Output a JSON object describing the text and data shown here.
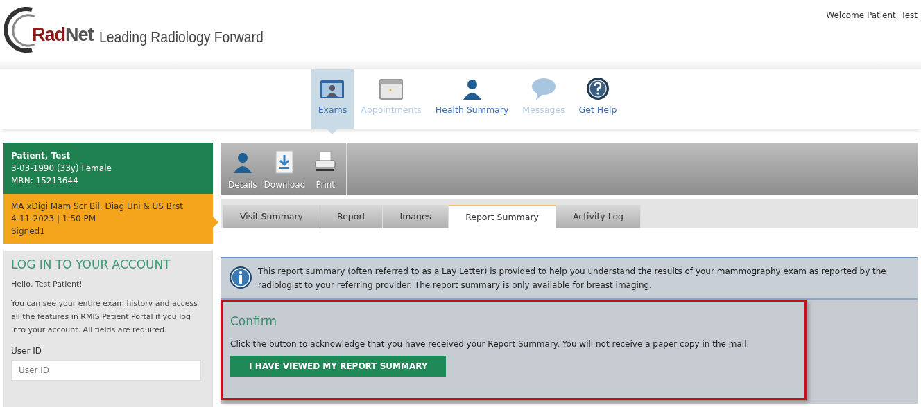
{
  "header": {
    "logo_brand": "RadNet",
    "logo_tagline": "Leading Radiology Forward",
    "welcome": "Welcome Patient, Test"
  },
  "nav": [
    {
      "label": "Exams",
      "kind": "folder",
      "selected": true,
      "disabled": false
    },
    {
      "label": "Appointments",
      "kind": "calendar",
      "selected": false,
      "disabled": true
    },
    {
      "label": "Health Summary",
      "kind": "person",
      "selected": false,
      "disabled": false
    },
    {
      "label": "Messages",
      "kind": "bubble",
      "selected": false,
      "disabled": true
    },
    {
      "label": "Get Help",
      "kind": "help",
      "selected": false,
      "disabled": false
    }
  ],
  "patient": {
    "name": "Patient, Test",
    "birth": "3-03-1990 (33y) Female",
    "mrn": "MRN: 15213644"
  },
  "exam": {
    "title": "MA xDigi Mam Scr Bil, Diag Uni & US Brst",
    "datetime": "4-11-2023 | 1:50 PM",
    "status": "Signed1",
    "selected": true
  },
  "login": {
    "title": "LOG IN TO YOUR ACCOUNT",
    "greeting": "Hello, Test Patient!",
    "text": "You can see your entire exam history and access all the features in RMIS Patient Portal if you log into your account. All fields are required.",
    "user_label": "User ID",
    "user_placeholder": "User ID"
  },
  "toolbar": [
    {
      "label": "Details",
      "kind": "person"
    },
    {
      "label": "Download",
      "kind": "download"
    },
    {
      "label": "Print",
      "kind": "printer"
    }
  ],
  "tabs": [
    {
      "label": "Visit Summary",
      "selected": false
    },
    {
      "label": "Report",
      "selected": false
    },
    {
      "label": "Images",
      "selected": false
    },
    {
      "label": "Report Summary",
      "selected": true
    },
    {
      "label": "Activity Log",
      "selected": false
    }
  ],
  "info": "This report summary (often referred to as a Lay Letter) is provided to help you understand the results of your mammography exam as reported by the radiologist to your referring provider. The report summary is only available for breast imaging.",
  "confirm": {
    "title": "Confirm",
    "text": "Click the button to acknowledge that you have received your Report Summary. You will not receive a paper copy in the mail.",
    "button": "I HAVE VIEWED MY REPORT SUMMARY",
    "highlighted": true
  }
}
